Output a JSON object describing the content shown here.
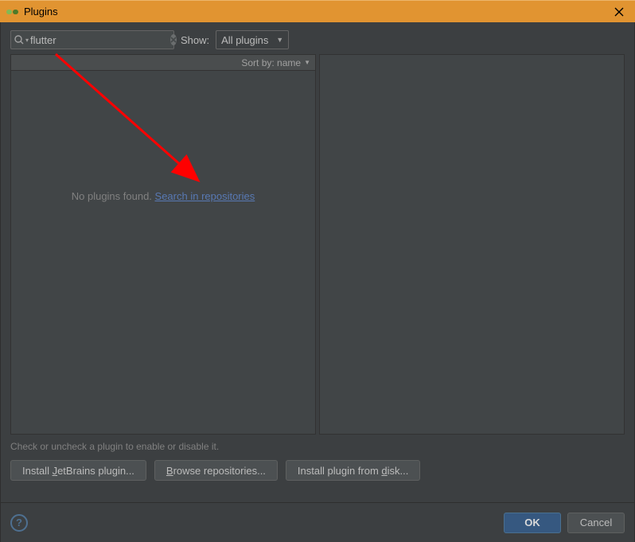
{
  "titlebar": {
    "title": "Plugins"
  },
  "search": {
    "value": "flutter",
    "show_label": "Show:",
    "filter_value": "All plugins"
  },
  "list": {
    "sort_label": "Sort by: name",
    "empty_text": "No plugins found. ",
    "search_link": "Search in repositories"
  },
  "hint": "Check or uncheck a plugin to enable or disable it.",
  "buttons": {
    "install_jetbrains": "Install JetBrains plugin...",
    "install_jetbrains_u": "J",
    "browse": "Browse repositories...",
    "browse_u": "B",
    "install_disk": "Install plugin from disk...",
    "install_disk_u": "d"
  },
  "footer": {
    "ok": "OK",
    "cancel": "Cancel"
  },
  "colors": {
    "titlebar_bg": "#e19431",
    "link": "#5879b4",
    "arrow": "#ff0000"
  }
}
